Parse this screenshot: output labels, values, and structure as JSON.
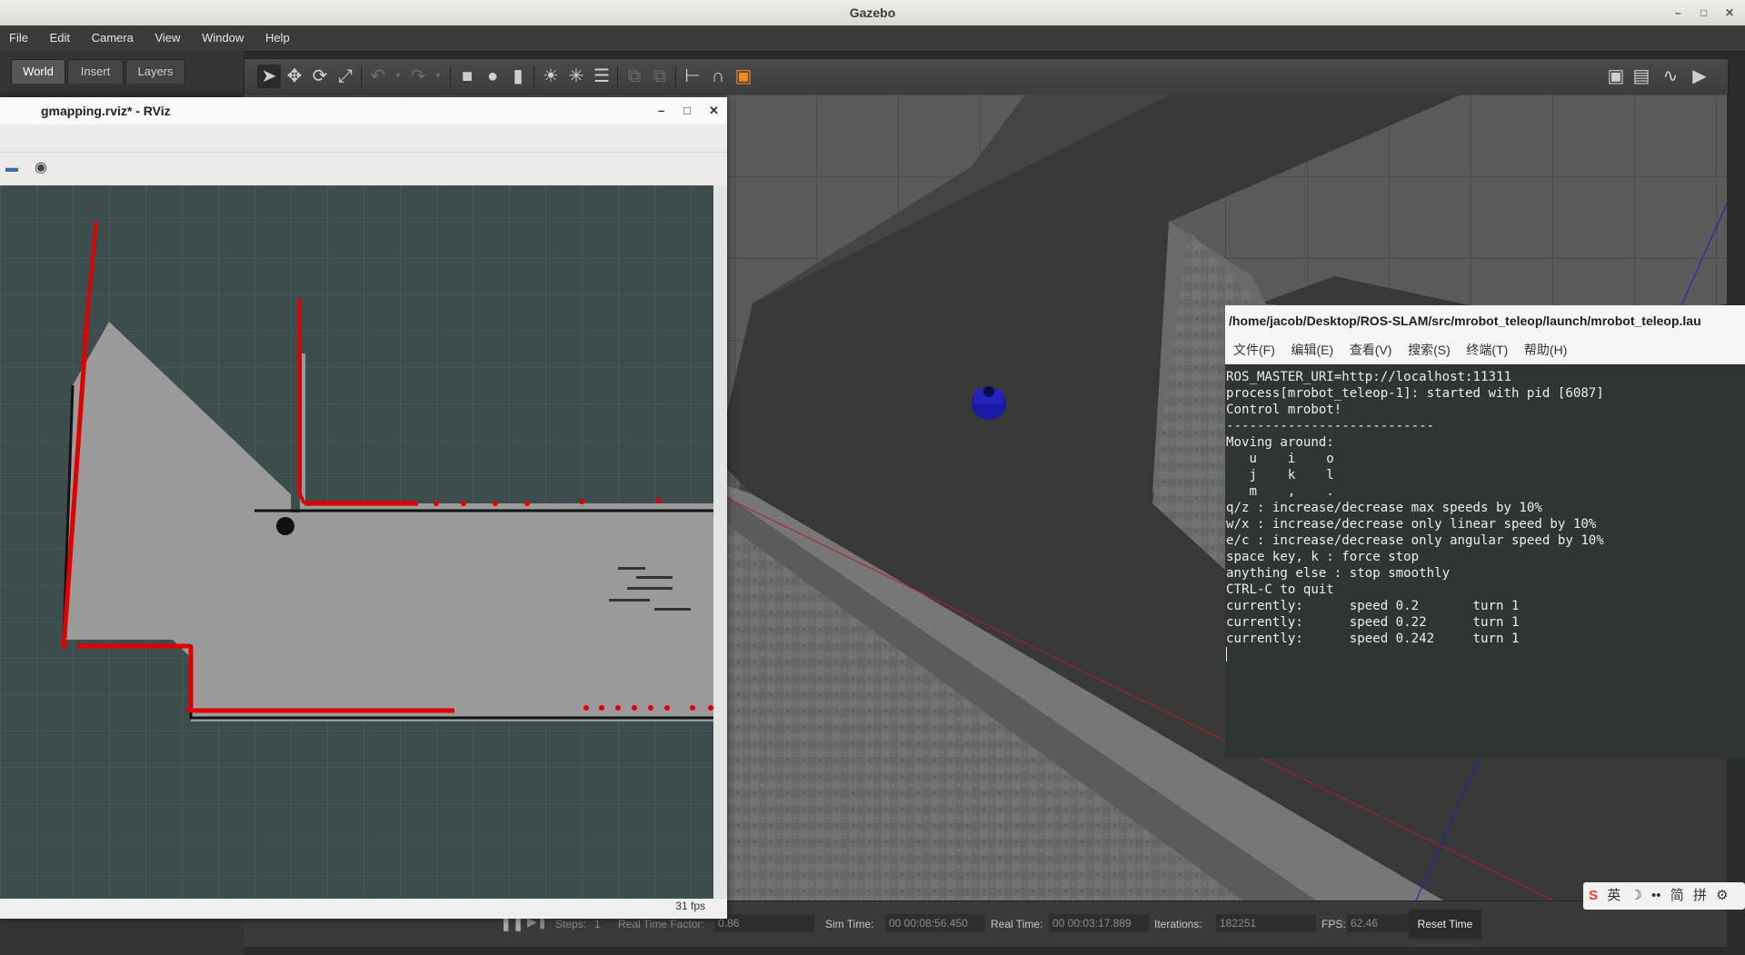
{
  "gazebo": {
    "title": "Gazebo",
    "menu": [
      "File",
      "Edit",
      "Camera",
      "View",
      "Window",
      "Help"
    ],
    "tabs": [
      "World",
      "Insert",
      "Layers"
    ],
    "status": {
      "steps_label": "Steps:",
      "steps_value": "1",
      "rtf_label": "Real Time Factor:",
      "rtf_value": "0.86",
      "sim_time_label": "Sim Time:",
      "sim_time_value": "00 00:08:56.450",
      "real_time_label": "Real Time:",
      "real_time_value": "00 00:03:17.889",
      "iterations_label": "Iterations:",
      "iterations_value": "182251",
      "fps_label": "FPS:",
      "fps_value": "62.46",
      "reset_label": "Reset Time"
    }
  },
  "rviz": {
    "title": "gmapping.rviz* - RViz",
    "fps": "31 fps"
  },
  "terminal": {
    "title": "/home/jacob/Desktop/ROS-SLAM/src/mrobot_teleop/launch/mrobot_teleop.lau",
    "menu": [
      "文件(F)",
      "编辑(E)",
      "查看(V)",
      "搜索(S)",
      "终端(T)",
      "帮助(H)"
    ],
    "lines": [
      "ROS_MASTER_URI=http://localhost:11311",
      "",
      "process[mrobot_teleop-1]: started with pid [6087]",
      "",
      "Control mrobot!",
      "---------------------------",
      "Moving around:",
      "   u    i    o",
      "   j    k    l",
      "   m    ,    .",
      "",
      "q/z : increase/decrease max speeds by 10%",
      "w/x : increase/decrease only linear speed by 10%",
      "e/c : increase/decrease only angular speed by 10%",
      "space key, k : force stop",
      "anything else : stop smoothly",
      "",
      "CTRL-C to quit",
      "",
      "currently:      speed 0.2       turn 1",
      "currently:      speed 0.22      turn 1",
      "currently:      speed 0.242     turn 1"
    ]
  },
  "ime": {
    "items": [
      "英",
      "简",
      "拼"
    ]
  },
  "colors": {
    "laser": "#e00000",
    "map_free": "#9a9a9a",
    "map_bg": "#3d4c4c",
    "robot": "#1a1aa8"
  }
}
